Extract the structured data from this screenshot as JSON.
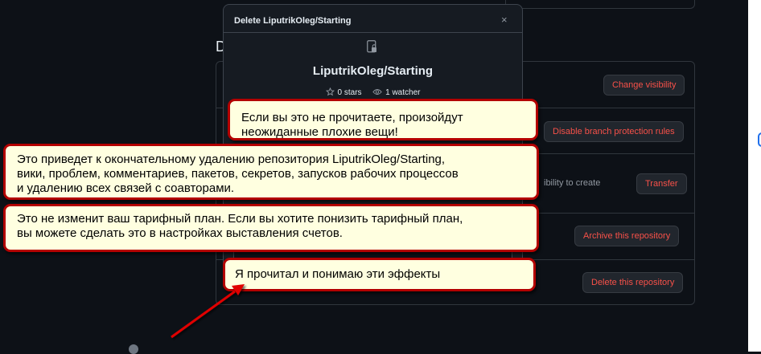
{
  "danger_zone": {
    "heading_partial": "D",
    "rows": [
      {
        "button": "Change visibility"
      },
      {
        "button": "Disable branch protection rules"
      },
      {
        "text_partial": "ibility to create",
        "button": "Transfer"
      },
      {
        "button": "Archive this repository"
      },
      {
        "button": "Delete this repository"
      }
    ]
  },
  "dialog": {
    "title": "Delete LiputrikOleg/Starting",
    "close_symbol": "×",
    "repo_name": "LiputrikOleg/Starting",
    "stars": "0 stars",
    "watchers": "1 watcher"
  },
  "callouts": {
    "c1_line1": "Если вы это не прочитаете, произойдут",
    "c1_line2": " неожиданные плохие вещи!",
    "c2_line1": "Это приведет к окончательному удалению репозитория LiputrikOleg/Starting,",
    "c2_line2": "вики, проблем, комментариев, пакетов, секретов, запусков рабочих процессов",
    "c2_line3": "и удалению всех связей с соавторами.",
    "c3_line1": "Это не изменит ваш тарифный план. Если вы хотите понизить тарифный план,",
    "c3_line2": "вы можете сделать это в настройках выставления счетов.",
    "c4_line1": "Я прочитал и понимаю эти эффекты"
  },
  "colors": {
    "background": "#0d1117",
    "dialog_bg": "#161b22",
    "danger_text": "#f85149",
    "callout_bg": "#ffffe0",
    "callout_border": "#b30000",
    "arrow": "#e00000"
  },
  "icons": [
    "repo-lock-icon",
    "star-icon",
    "eye-icon",
    "close-icon",
    "github-logo-icon"
  ]
}
